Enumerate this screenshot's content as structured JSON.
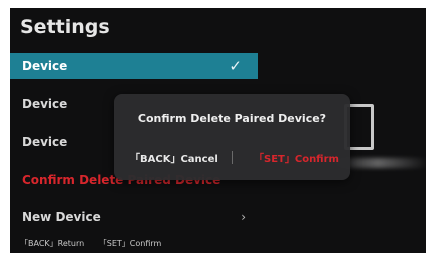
{
  "title": "Settings",
  "menu": {
    "items": [
      {
        "label": "Device"
      },
      {
        "label": "Device"
      },
      {
        "label": "Device"
      },
      {
        "label": "Confirm Delete Paired Device"
      },
      {
        "label": "New Device"
      }
    ],
    "check_icon": "✓",
    "chevron_icon": "›"
  },
  "hint_bar": {
    "back": "「BACK」Return",
    "set": "「SET」Confirm"
  },
  "dialog": {
    "title": "Confirm Delete Paired Device?",
    "cancel": "「BACK」Cancel",
    "confirm": "「SET」Confirm"
  },
  "colors": {
    "selection": "#1e8094",
    "danger": "#d7262c",
    "background": "#0f0f10"
  }
}
